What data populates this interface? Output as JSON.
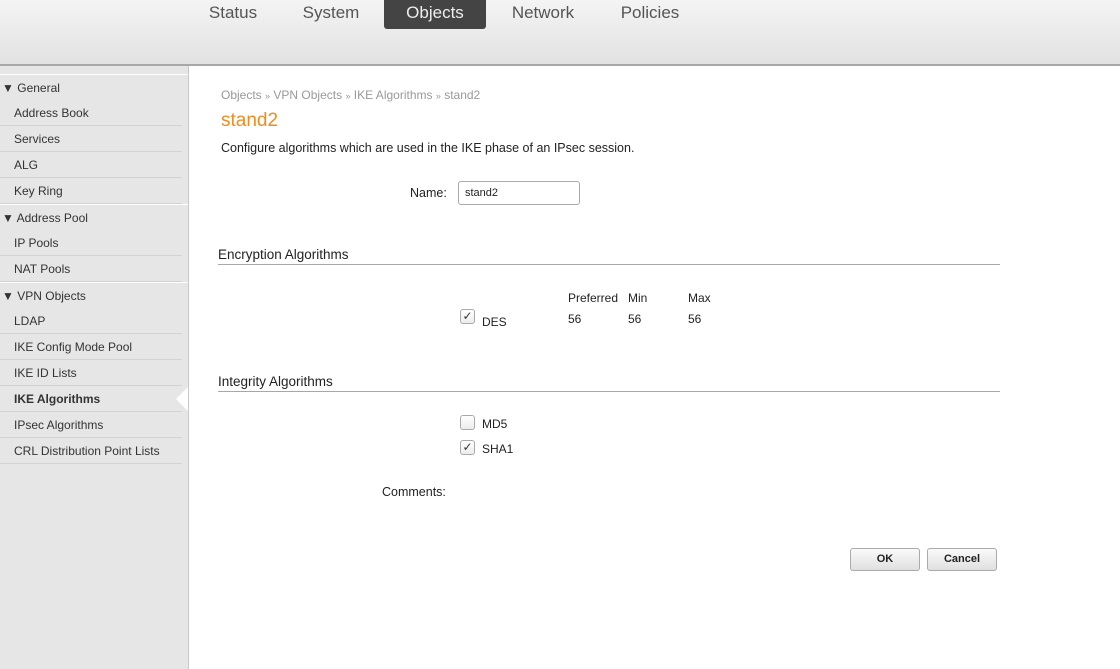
{
  "nav": {
    "tabs": [
      "Status",
      "System",
      "Objects",
      "Network",
      "Policies"
    ],
    "active": "Objects"
  },
  "sidebar": {
    "sections": [
      {
        "label": "General",
        "items": [
          "Address Book",
          "Services",
          "ALG",
          "Key Ring"
        ]
      },
      {
        "label": "Address Pool",
        "items": [
          "IP Pools",
          "NAT Pools"
        ]
      },
      {
        "label": "VPN Objects",
        "items": [
          "LDAP",
          "IKE Config Mode Pool",
          "IKE ID Lists",
          "IKE Algorithms",
          "IPsec Algorithms",
          "CRL Distribution Point Lists"
        ]
      }
    ],
    "active": "IKE Algorithms"
  },
  "breadcrumb": [
    "Objects",
    "VPN Objects",
    "IKE Algorithms",
    "stand2"
  ],
  "breadcrumb_sep": "»",
  "title": "stand2",
  "description": "Configure algorithms which are used in the IKE phase of an IPsec session.",
  "form": {
    "name_label": "Name:",
    "name_value": "stand2",
    "comments_label": "Comments:",
    "comments_value": ""
  },
  "encryption": {
    "heading": "Encryption Algorithms",
    "columns": [
      "Preferred",
      "Min",
      "Max"
    ],
    "rows": [
      {
        "label": "DES",
        "checked": true,
        "preferred": "56",
        "min": "56",
        "max": "56"
      }
    ]
  },
  "integrity": {
    "heading": "Integrity Algorithms",
    "items": [
      {
        "label": "MD5",
        "checked": false
      },
      {
        "label": "SHA1",
        "checked": true
      }
    ]
  },
  "buttons": {
    "ok": "OK",
    "cancel": "Cancel"
  },
  "colors": {
    "title": "#f08c1e",
    "active_tab": "#444444"
  }
}
